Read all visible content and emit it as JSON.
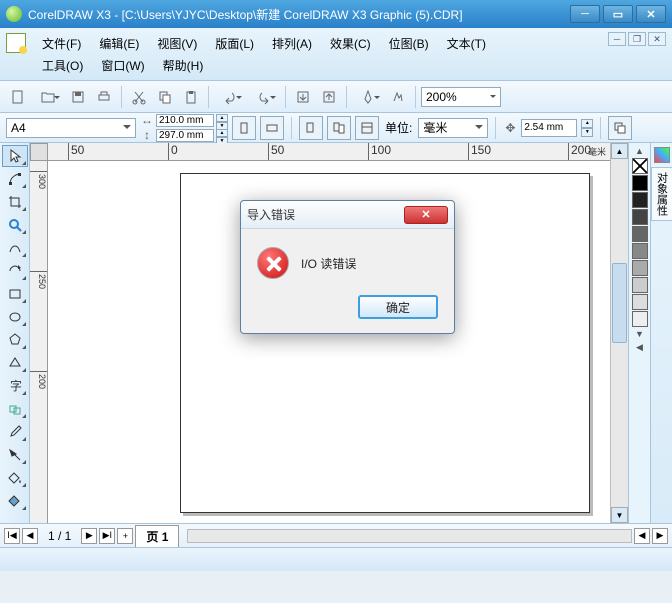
{
  "title": "CorelDRAW X3 - [C:\\Users\\YJYC\\Desktop\\新建 CorelDRAW X3 Graphic (5).CDR]",
  "menu": {
    "row1": [
      "文件(F)",
      "编辑(E)",
      "视图(V)",
      "版面(L)",
      "排列(A)",
      "效果(C)",
      "位图(B)",
      "文本(T)"
    ],
    "row2": [
      "工具(O)",
      "窗口(W)",
      "帮助(H)"
    ]
  },
  "zoom": "200%",
  "prop": {
    "paper": "A4",
    "width": "210.0 mm",
    "height": "297.0 mm",
    "unit_label": "单位:",
    "unit_value": "毫米",
    "nudge": "2.54 mm"
  },
  "ruler": {
    "h": [
      "50",
      "0",
      "50",
      "100",
      "150",
      "200"
    ],
    "h_unit": "毫米",
    "v": [
      "300",
      "250",
      "200"
    ]
  },
  "palette_colors": [
    "#000000",
    "#ffffff",
    "#1e3a8a",
    "#333333",
    "#555555",
    "#777777",
    "#999999",
    "#bbbbbb",
    "#dddddd",
    "#eeeeee"
  ],
  "docker_label": "对象属性",
  "pagebar": {
    "counter": "1 / 1",
    "tab": "页 1"
  },
  "status": "",
  "dialog": {
    "title": "导入错误",
    "message": "I/O 读错误",
    "ok": "确定"
  }
}
